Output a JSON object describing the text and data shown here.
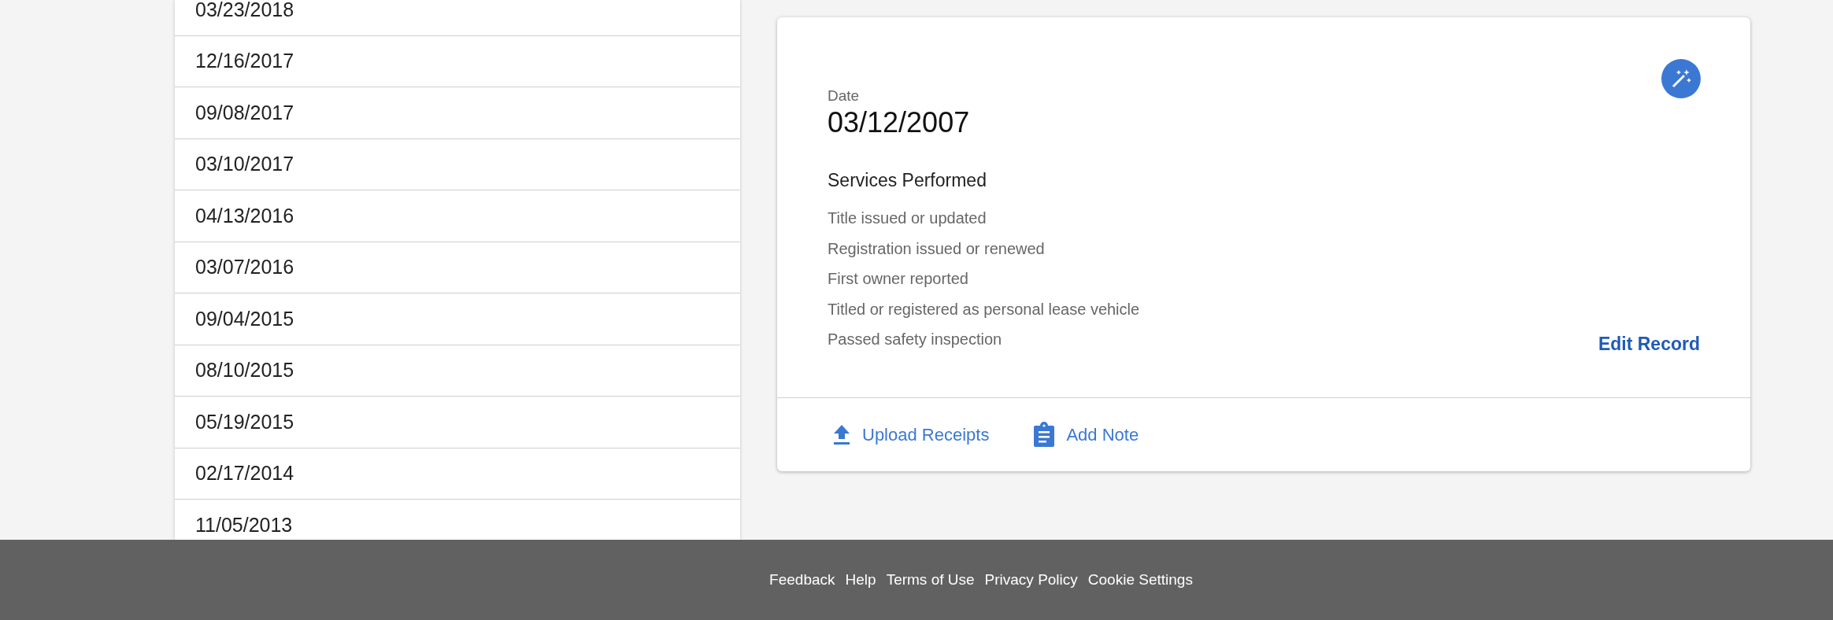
{
  "record_list": [
    {
      "date": "03/23/2018"
    },
    {
      "date": "12/16/2017"
    },
    {
      "date": "09/08/2017"
    },
    {
      "date": "03/10/2017"
    },
    {
      "date": "04/13/2016"
    },
    {
      "date": "03/07/2016"
    },
    {
      "date": "09/04/2015"
    },
    {
      "date": "08/10/2015"
    },
    {
      "date": "05/19/2015"
    },
    {
      "date": "02/17/2014"
    },
    {
      "date": "11/05/2013"
    }
  ],
  "record_card": {
    "date_label": "Date",
    "date": "03/12/2007",
    "services_title": "Services Performed",
    "services": [
      "Title issued or updated",
      "Registration issued or renewed",
      "First owner reported",
      "Titled or registered as personal lease vehicle",
      "Passed safety inspection"
    ],
    "edit_link": "Edit Record",
    "actions": [
      {
        "kind": "upload",
        "label": "Upload Receipts"
      },
      {
        "kind": "note",
        "label": "Add Note"
      }
    ]
  },
  "footer_links": [
    "Feedback",
    "Help",
    "Terms of Use",
    "Privacy Policy",
    "Cookie Settings"
  ]
}
